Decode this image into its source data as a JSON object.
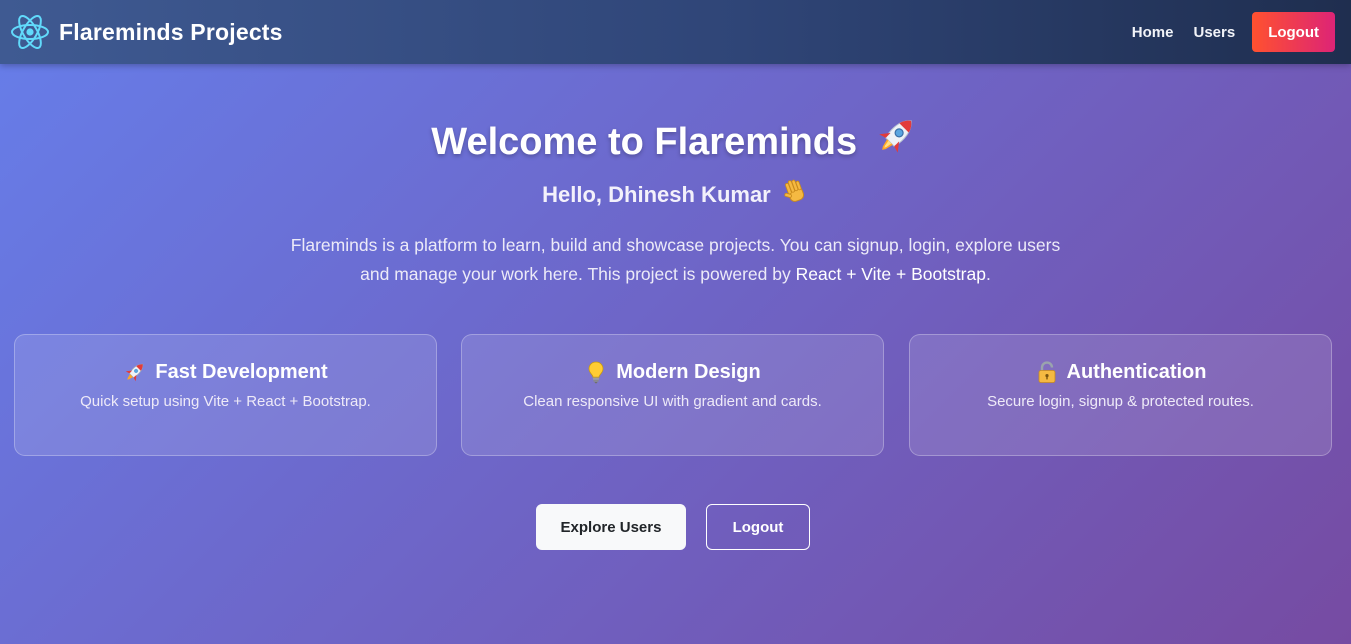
{
  "navbar": {
    "brand": "Flareminds Projects",
    "logo_icon": "react-atom-icon",
    "links": [
      {
        "label": "Home"
      },
      {
        "label": "Users"
      }
    ],
    "logout_label": "Logout"
  },
  "hero": {
    "title": "Welcome to Flareminds",
    "title_emoji": "🚀",
    "greeting": "Hello, Dhinesh Kumar",
    "greeting_emoji": "👋",
    "description": "Flareminds is a platform to learn, build and showcase projects. You can signup, login, explore users and manage your work here. This project is powered by",
    "tech_stack": "React + Vite + Bootstrap",
    "description_end": "."
  },
  "features": [
    {
      "icon": "rocket-icon",
      "title": "Fast Development",
      "text": "Quick setup using Vite + React + Bootstrap."
    },
    {
      "icon": "lightbulb-icon",
      "title": "Modern Design",
      "text": "Clean responsive UI with gradient and cards."
    },
    {
      "icon": "lock-icon",
      "title": "Authentication",
      "text": "Secure login, signup & protected routes."
    }
  ],
  "actions": {
    "explore_label": "Explore Users",
    "logout_label": "Logout"
  },
  "colors": {
    "gradient_start": "#667eea",
    "gradient_end": "#764ba2",
    "logout_start": "#ff512f",
    "logout_end": "#dd2476",
    "react_cyan": "#61dafb"
  }
}
